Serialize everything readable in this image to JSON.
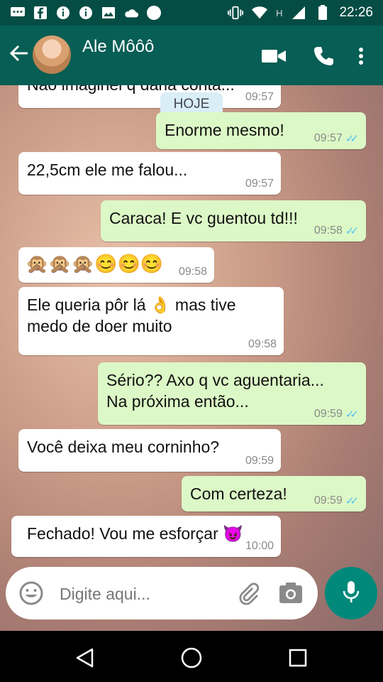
{
  "status_bar": {
    "time": "22:26",
    "network_letter": "H"
  },
  "header": {
    "contact_name": "Ale Môôô"
  },
  "chat": {
    "date_separator": "HOJE",
    "messages": [
      {
        "text": "Não imaginei q daria conta...",
        "time": "09:57",
        "direction": "in"
      },
      {
        "text": "Enorme mesmo!",
        "time": "09:57",
        "direction": "out"
      },
      {
        "text": "22,5cm ele me falou...",
        "time": "09:57",
        "direction": "in"
      },
      {
        "text": "Caraca! E vc guentou td!!!",
        "time": "09:58",
        "direction": "out"
      },
      {
        "text": "🙊🙊🙊😊😊😊",
        "time": "09:58",
        "direction": "in"
      },
      {
        "text": "Ele queria pôr lá 👌 mas tive\nmedo de doer muito",
        "time": "09:58",
        "direction": "in"
      },
      {
        "text": "Sério?? Axo q vc aguentaria...\nNa próxima então...",
        "time": "09:59",
        "direction": "out"
      },
      {
        "text": "Você deixa meu corninho?",
        "time": "09:59",
        "direction": "in"
      },
      {
        "text": "Com certeza!",
        "time": "09:59",
        "direction": "out"
      },
      {
        "text": "Fechado! Vou me esforçar 😈",
        "time": "10:00",
        "direction": "in"
      }
    ]
  },
  "composer": {
    "placeholder": "Digite aqui..."
  },
  "colors": {
    "header": "#075e54",
    "status_bar": "#054d44",
    "outgoing": "#dcf8c6",
    "incoming": "#ffffff",
    "fab": "#00897b",
    "read_ticks": "#4fc3f7"
  },
  "icons": [
    "back-arrow-icon",
    "video-call-icon",
    "phone-icon",
    "more-vert-icon",
    "emoji-icon",
    "attach-icon",
    "camera-icon",
    "mic-icon"
  ]
}
